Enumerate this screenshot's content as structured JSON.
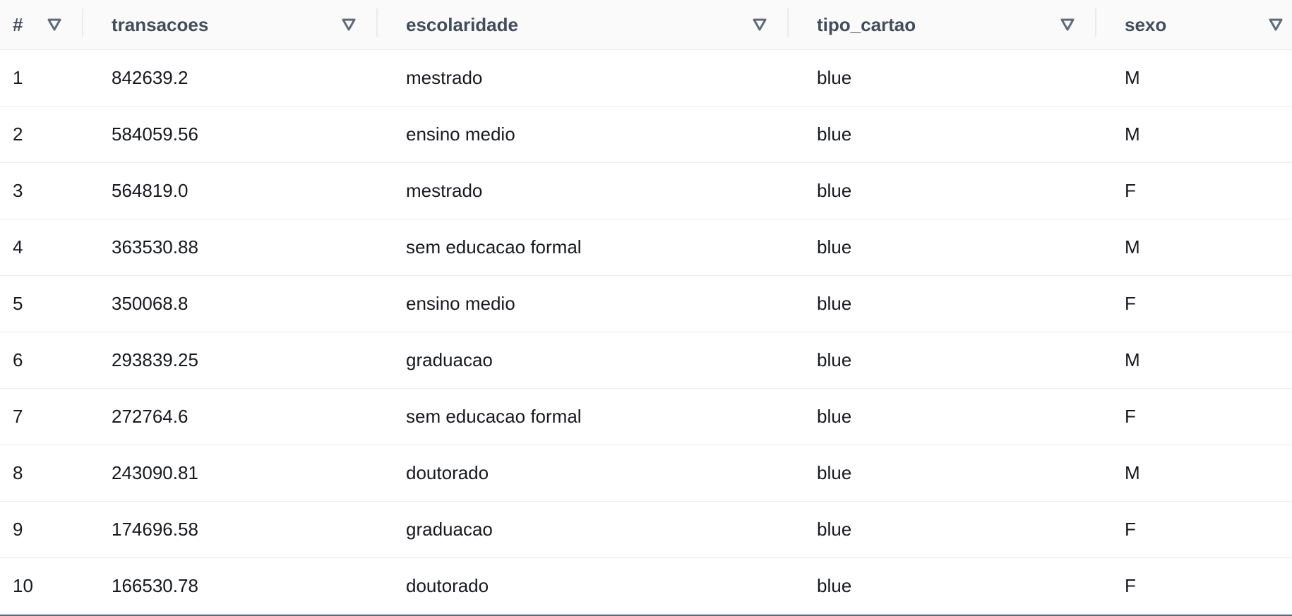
{
  "table": {
    "columns": [
      {
        "label": "#",
        "icon": "caret-down-icon"
      },
      {
        "label": "transacoes",
        "icon": "caret-down-icon"
      },
      {
        "label": "escolaridade",
        "icon": "caret-down-icon"
      },
      {
        "label": "tipo_cartao",
        "icon": "caret-down-icon"
      },
      {
        "label": "sexo",
        "icon": "caret-down-icon"
      }
    ],
    "rows": [
      [
        "1",
        "842639.2",
        "mestrado",
        "blue",
        "M"
      ],
      [
        "2",
        "584059.56",
        "ensino medio",
        "blue",
        "M"
      ],
      [
        "3",
        "564819.0",
        "mestrado",
        "blue",
        "F"
      ],
      [
        "4",
        "363530.88",
        "sem educacao formal",
        "blue",
        "M"
      ],
      [
        "5",
        "350068.8",
        "ensino medio",
        "blue",
        "F"
      ],
      [
        "6",
        "293839.25",
        "graduacao",
        "blue",
        "M"
      ],
      [
        "7",
        "272764.6",
        "sem educacao formal",
        "blue",
        "F"
      ],
      [
        "8",
        "243090.81",
        "doutorado",
        "blue",
        "M"
      ],
      [
        "9",
        "174696.58",
        "graduacao",
        "blue",
        "F"
      ],
      [
        "10",
        "166530.78",
        "doutorado",
        "blue",
        "F"
      ]
    ]
  },
  "colors": {
    "header_bg": "#fafafa",
    "header_text": "#414d5c",
    "body_text": "#16191f",
    "row_border": "#e9ebed",
    "icon": "#5f6b7a"
  }
}
